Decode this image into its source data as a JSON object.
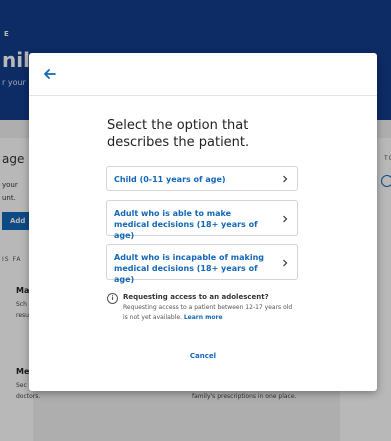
{
  "background": {
    "brand": "E",
    "title": "nily",
    "subtitle": "r your",
    "manage_title": "age",
    "your_text": "your",
    "unt_text": "unt.",
    "add_label": "Add",
    "section_label": "IS FA",
    "card1_title": "Ma",
    "card1_line1": "Sch",
    "card1_line2": "resu",
    "card2_title": "Me",
    "card2_line1": "Sec",
    "card2_line2": "doctors.",
    "card2_right": "family's prescriptions in one place.",
    "right_label": "TO"
  },
  "modal": {
    "prompt": "Select the option that describes the patient.",
    "options": [
      {
        "label": "Child (0-11 years of age)"
      },
      {
        "label": "Adult who is able to make medical decisions (18+ years of age)"
      },
      {
        "label": "Adult who is incapable of making medical decisions (18+ years of age)"
      }
    ],
    "info": {
      "title": "Requesting access to an adolescent?",
      "body": "Requesting access to a patient between 12-17 years old is not yet available.",
      "link": "Learn more"
    },
    "cancel_label": "Cancel"
  },
  "colors": {
    "header_blue": "#123c8c",
    "link_blue": "#1467b8"
  },
  "icons": {
    "back": "arrow-left-icon",
    "option_chevron": "chevron-right-icon",
    "info": "info-icon"
  }
}
